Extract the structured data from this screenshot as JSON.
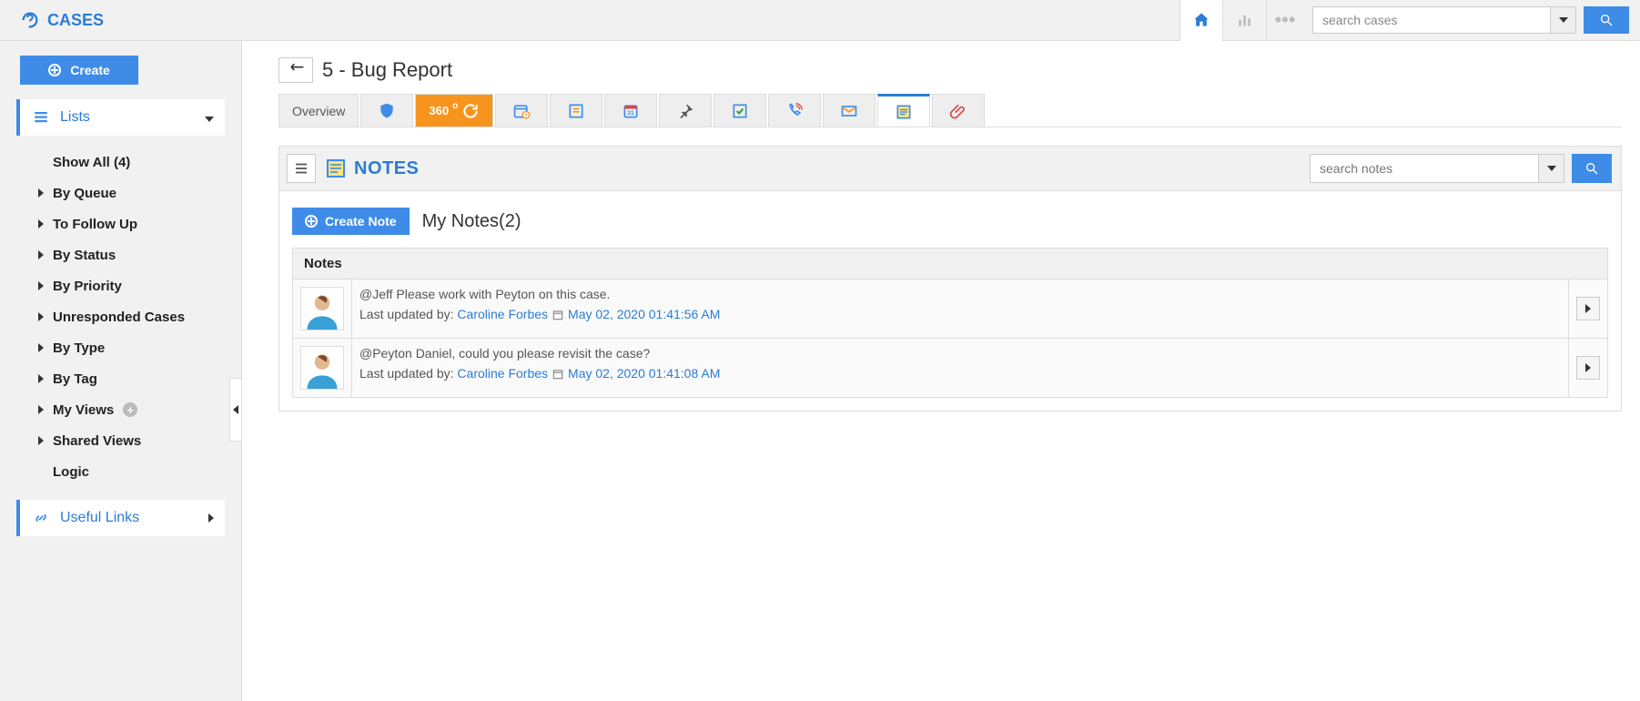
{
  "brand": {
    "title": "CASES"
  },
  "top": {
    "search_placeholder": "search cases"
  },
  "sidebar": {
    "create_label": "Create",
    "lists_label": "Lists",
    "items": [
      {
        "label": "Show All (4)",
        "arrow": false
      },
      {
        "label": "By Queue",
        "arrow": true
      },
      {
        "label": "To Follow Up",
        "arrow": true
      },
      {
        "label": "By Status",
        "arrow": true
      },
      {
        "label": "By Priority",
        "arrow": true
      },
      {
        "label": "Unresponded Cases",
        "arrow": true
      },
      {
        "label": "By Type",
        "arrow": true
      },
      {
        "label": "By Tag",
        "arrow": true
      },
      {
        "label": "My Views",
        "arrow": true,
        "plus": true
      },
      {
        "label": "Shared Views",
        "arrow": true
      },
      {
        "label": "Logic",
        "arrow": false
      }
    ],
    "useful_links_label": "Useful Links"
  },
  "page": {
    "title": "5 - Bug Report"
  },
  "tabs": {
    "overview_label": "Overview",
    "deg360_label": "360"
  },
  "notes": {
    "header_label": "NOTES",
    "search_placeholder": "search notes",
    "create_label": "Create Note",
    "count_label": "My Notes(2)",
    "column_label": "Notes",
    "rows": [
      {
        "text": "@Jeff Please work with Peyton on this case.",
        "lastby_label": "Last updated by: ",
        "who": "Caroline Forbes",
        "when": "May 02, 2020 01:41:56 AM"
      },
      {
        "text": "@Peyton Daniel, could you please revisit the case?",
        "lastby_label": "Last updated by: ",
        "who": "Caroline Forbes",
        "when": "May 02, 2020 01:41:08 AM"
      }
    ]
  }
}
